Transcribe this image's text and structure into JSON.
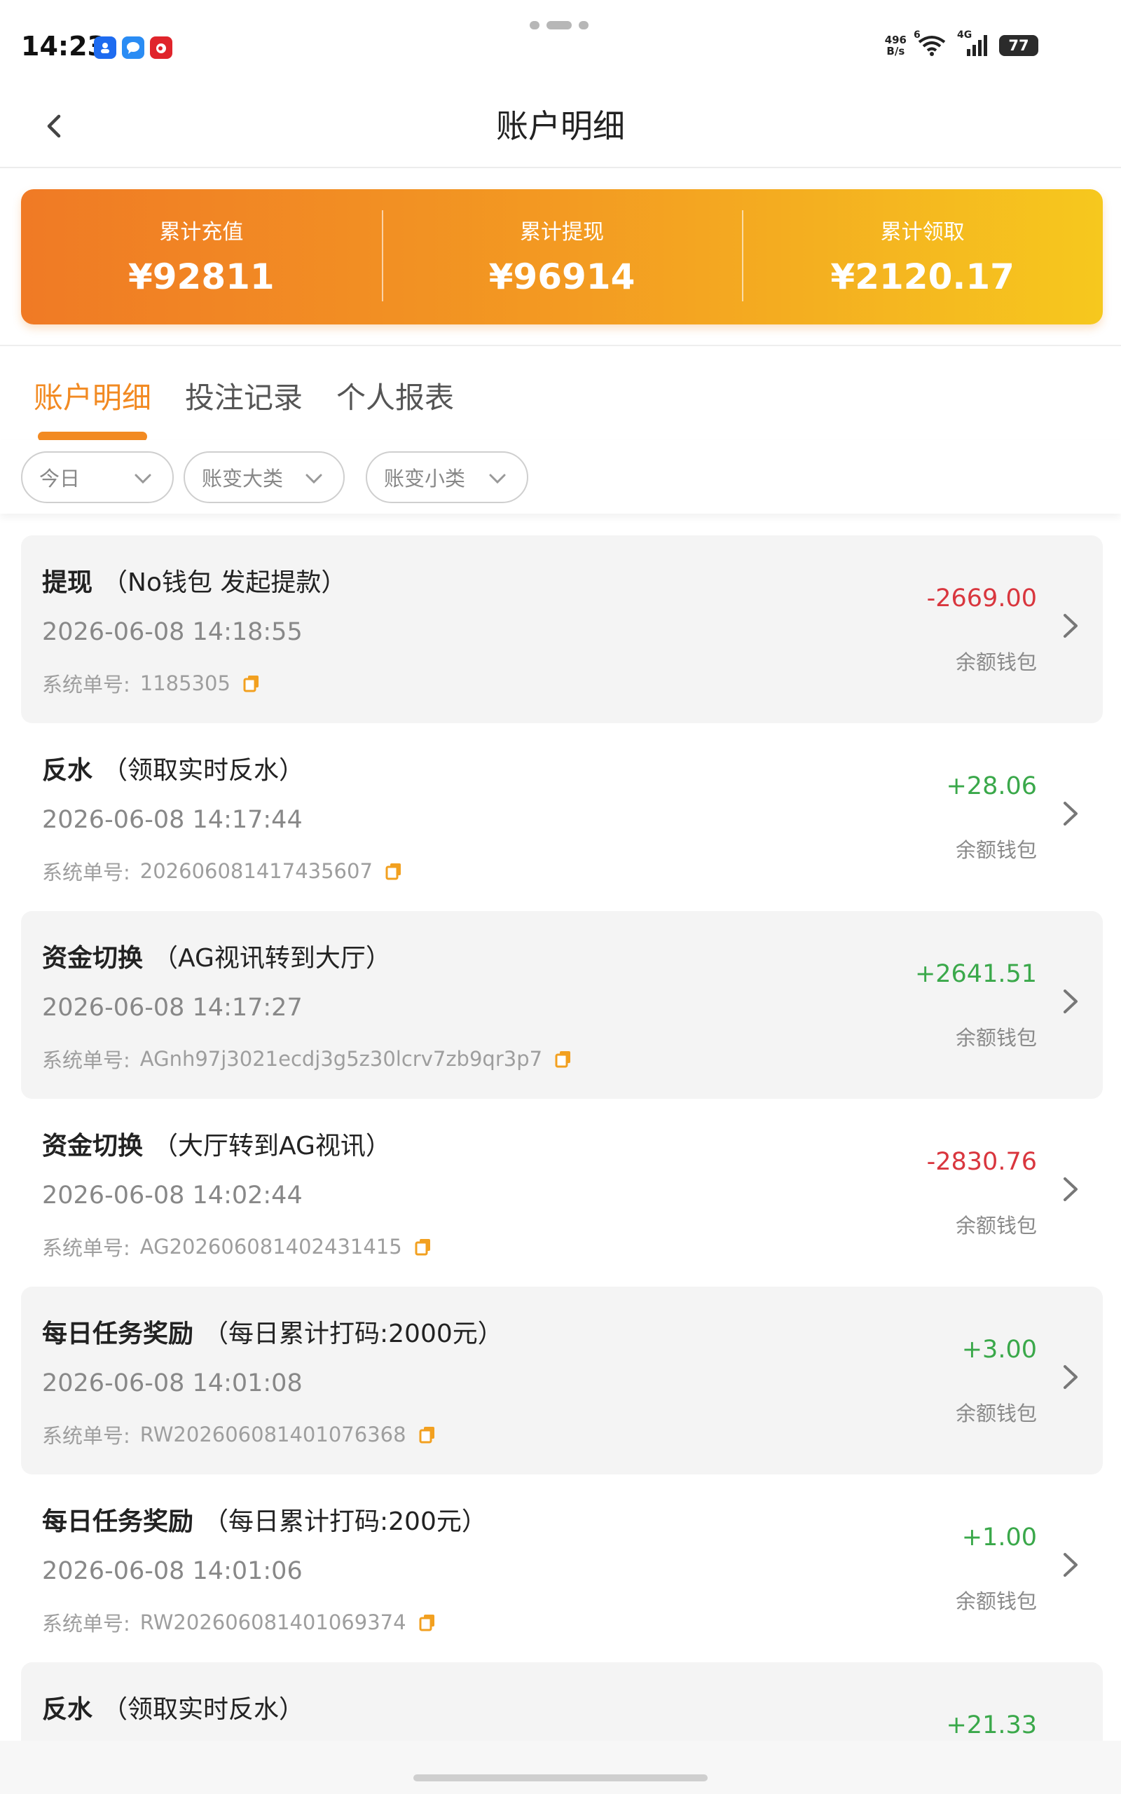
{
  "status_bar": {
    "time": "14:23",
    "net_speed_top": "496",
    "net_speed_bottom": "B/s",
    "wifi_label": "6",
    "cell_label": "4G",
    "battery": "77",
    "icons": [
      "profile-app-icon",
      "chat-app-icon",
      "weibo-app-icon",
      "wifi-icon",
      "cellular-signal-icon",
      "battery-icon"
    ]
  },
  "header": {
    "title": "账户明细",
    "back_icon": "chevron-left-icon"
  },
  "summary": {
    "colors": {
      "gradient_start": "#f07a25",
      "gradient_end": "#f6c81e"
    },
    "stats": [
      {
        "label": "累计充值",
        "value": "¥92811"
      },
      {
        "label": "累计提现",
        "value": "¥96914"
      },
      {
        "label": "累计领取",
        "value": "¥2120.17"
      }
    ]
  },
  "tabs": {
    "active_color": "#f28a22",
    "items": [
      {
        "label": "账户明细",
        "active": true
      },
      {
        "label": "投注记录",
        "active": false
      },
      {
        "label": "个人报表",
        "active": false
      }
    ]
  },
  "filters": [
    {
      "label": "今日",
      "icon": "chevron-down-icon"
    },
    {
      "label": "账变大类",
      "icon": "chevron-down-icon"
    },
    {
      "label": "账变小类",
      "icon": "chevron-down-icon"
    }
  ],
  "records": {
    "order_label": "系统单号:",
    "colors": {
      "negative": "#d9363e",
      "positive": "#3aa84a"
    },
    "items": [
      {
        "kind": "提现",
        "desc": "（No钱包 发起提款）",
        "time": "2026-06-08 14:18:55",
        "order": "1185305",
        "amount": "-2669.00",
        "wallet": "余额钱包",
        "sign": "neg"
      },
      {
        "kind": "反水",
        "desc": "（领取实时反水）",
        "time": "2026-06-08 14:17:44",
        "order": "202606081417435607",
        "amount": "+28.06",
        "wallet": "余额钱包",
        "sign": "pos"
      },
      {
        "kind": "资金切换",
        "desc": "（AG视讯转到大厅）",
        "time": "2026-06-08 14:17:27",
        "order": "AGnh97j3021ecdj3g5z30lcrv7zb9qr3p7",
        "amount": "+2641.51",
        "wallet": "余额钱包",
        "sign": "pos"
      },
      {
        "kind": "资金切换",
        "desc": "（大厅转到AG视讯）",
        "time": "2026-06-08 14:02:44",
        "order": "AG202606081402431415",
        "amount": "-2830.76",
        "wallet": "余额钱包",
        "sign": "neg"
      },
      {
        "kind": "每日任务奖励",
        "desc": "（每日累计打码:2000元）",
        "time": "2026-06-08 14:01:08",
        "order": "RW202606081401076368",
        "amount": "+3.00",
        "wallet": "余额钱包",
        "sign": "pos"
      },
      {
        "kind": "每日任务奖励",
        "desc": "（每日累计打码:200元）",
        "time": "2026-06-08 14:01:06",
        "order": "RW202606081401069374",
        "amount": "+1.00",
        "wallet": "余额钱包",
        "sign": "pos"
      },
      {
        "kind": "反水",
        "desc": "（领取实时反水）",
        "time": "",
        "order": "",
        "amount": "+21.33",
        "wallet": "",
        "sign": "pos"
      }
    ]
  }
}
